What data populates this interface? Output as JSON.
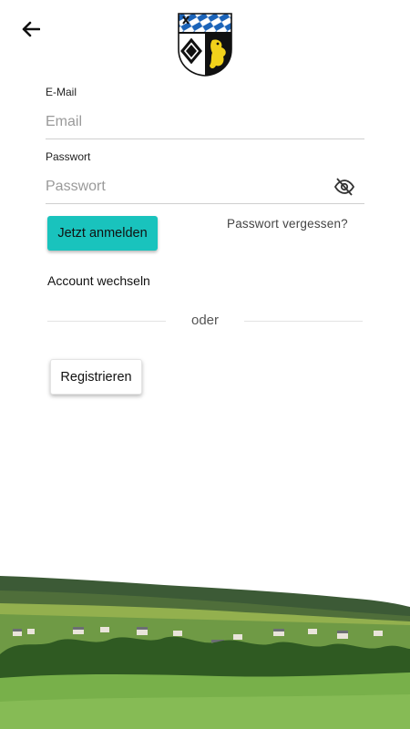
{
  "header": {
    "back_icon": "arrow-left-icon",
    "logo": "coat-of-arms-logo"
  },
  "form": {
    "email": {
      "label": "E-Mail",
      "placeholder": "Email",
      "value": ""
    },
    "password": {
      "label": "Passwort",
      "placeholder": "Passwort",
      "value": "",
      "toggle_icon": "eye-off-icon"
    }
  },
  "actions": {
    "login_label": "Jetzt anmelden",
    "forgot_label": "Passwort vergessen?",
    "switch_account_label": "Account wechseln",
    "divider_label": "oder",
    "register_label": "Registrieren"
  },
  "colors": {
    "accent": "#19c3bd",
    "crest_blue": "#1b63b8",
    "crest_gold": "#f2d21b",
    "grass": "#78b04a"
  },
  "footer": {
    "image": "village-landscape-image"
  }
}
